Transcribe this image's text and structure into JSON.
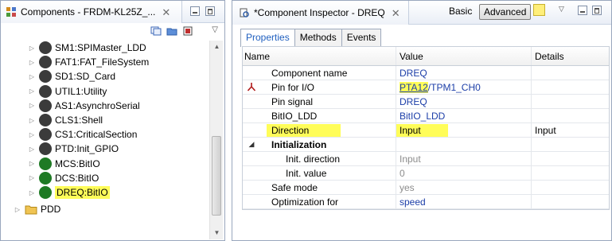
{
  "left_view": {
    "title": "Components - FRDM-KL25Z_...",
    "tree": [
      {
        "label": "SM1:SPIMaster_LDD",
        "icon_color": "#3b3b3b",
        "icon_char": "⚙"
      },
      {
        "label": "FAT1:FAT_FileSystem",
        "icon_color": "#3b3b3b",
        "icon_char": "F"
      },
      {
        "label": "SD1:SD_Card",
        "icon_color": "#3b3b3b",
        "icon_char": "S"
      },
      {
        "label": "UTIL1:Utility",
        "icon_color": "#3b3b3b",
        "icon_char": "U"
      },
      {
        "label": "AS1:AsynchroSerial",
        "icon_color": "#3b3b3b",
        "icon_char": "A"
      },
      {
        "label": "CLS1:Shell",
        "icon_color": "#3b3b3b",
        "icon_char": "C"
      },
      {
        "label": "CS1:CriticalSection",
        "icon_color": "#3b3b3b",
        "icon_char": "C"
      },
      {
        "label": "PTD:Init_GPIO",
        "icon_color": "#3b3b3b",
        "icon_char": "P"
      },
      {
        "label": "MCS:BitIO",
        "icon_color": "#1e7a24",
        "icon_char": "/"
      },
      {
        "label": "DCS:BitIO",
        "icon_color": "#1e7a24",
        "icon_char": "/"
      },
      {
        "label": "DREQ:BitIO",
        "icon_color": "#1e7a24",
        "icon_char": "/"
      }
    ],
    "folder_label": "PDD"
  },
  "inspector": {
    "title": "*Component Inspector - DREQ",
    "mode_basic": "Basic",
    "mode_advanced": "Advanced",
    "tabs": [
      "Properties",
      "Methods",
      "Events"
    ],
    "columns": [
      "Name",
      "Value",
      "Details"
    ],
    "rows": [
      {
        "name": "Component name",
        "value": "DREQ",
        "value2": "",
        "details": ""
      },
      {
        "name": "Pin for I/O",
        "value": "PTA12",
        "value2": "/TPM1_CH0",
        "details": ""
      },
      {
        "name": "Pin signal",
        "value": "DREQ",
        "value2": "",
        "details": ""
      },
      {
        "name": "BitIO_LDD",
        "value": "BitIO_LDD",
        "value2": "",
        "details": ""
      },
      {
        "name": "Direction",
        "value": "Input",
        "value2": "",
        "details": "Input"
      },
      {
        "name": "Initialization",
        "value": "",
        "value2": "",
        "details": ""
      },
      {
        "name": "Init. direction",
        "value": "Input",
        "value2": "",
        "details": ""
      },
      {
        "name": "Init. value",
        "value": "0",
        "value2": "",
        "details": ""
      },
      {
        "name": "Safe mode",
        "value": "yes",
        "value2": "",
        "details": ""
      },
      {
        "name": "Optimization for",
        "value": "speed",
        "value2": "",
        "details": ""
      }
    ]
  },
  "colors": {
    "highlight": "#fffd59",
    "link_blue": "#1c3ea8",
    "accent": "#1f5fbf"
  }
}
